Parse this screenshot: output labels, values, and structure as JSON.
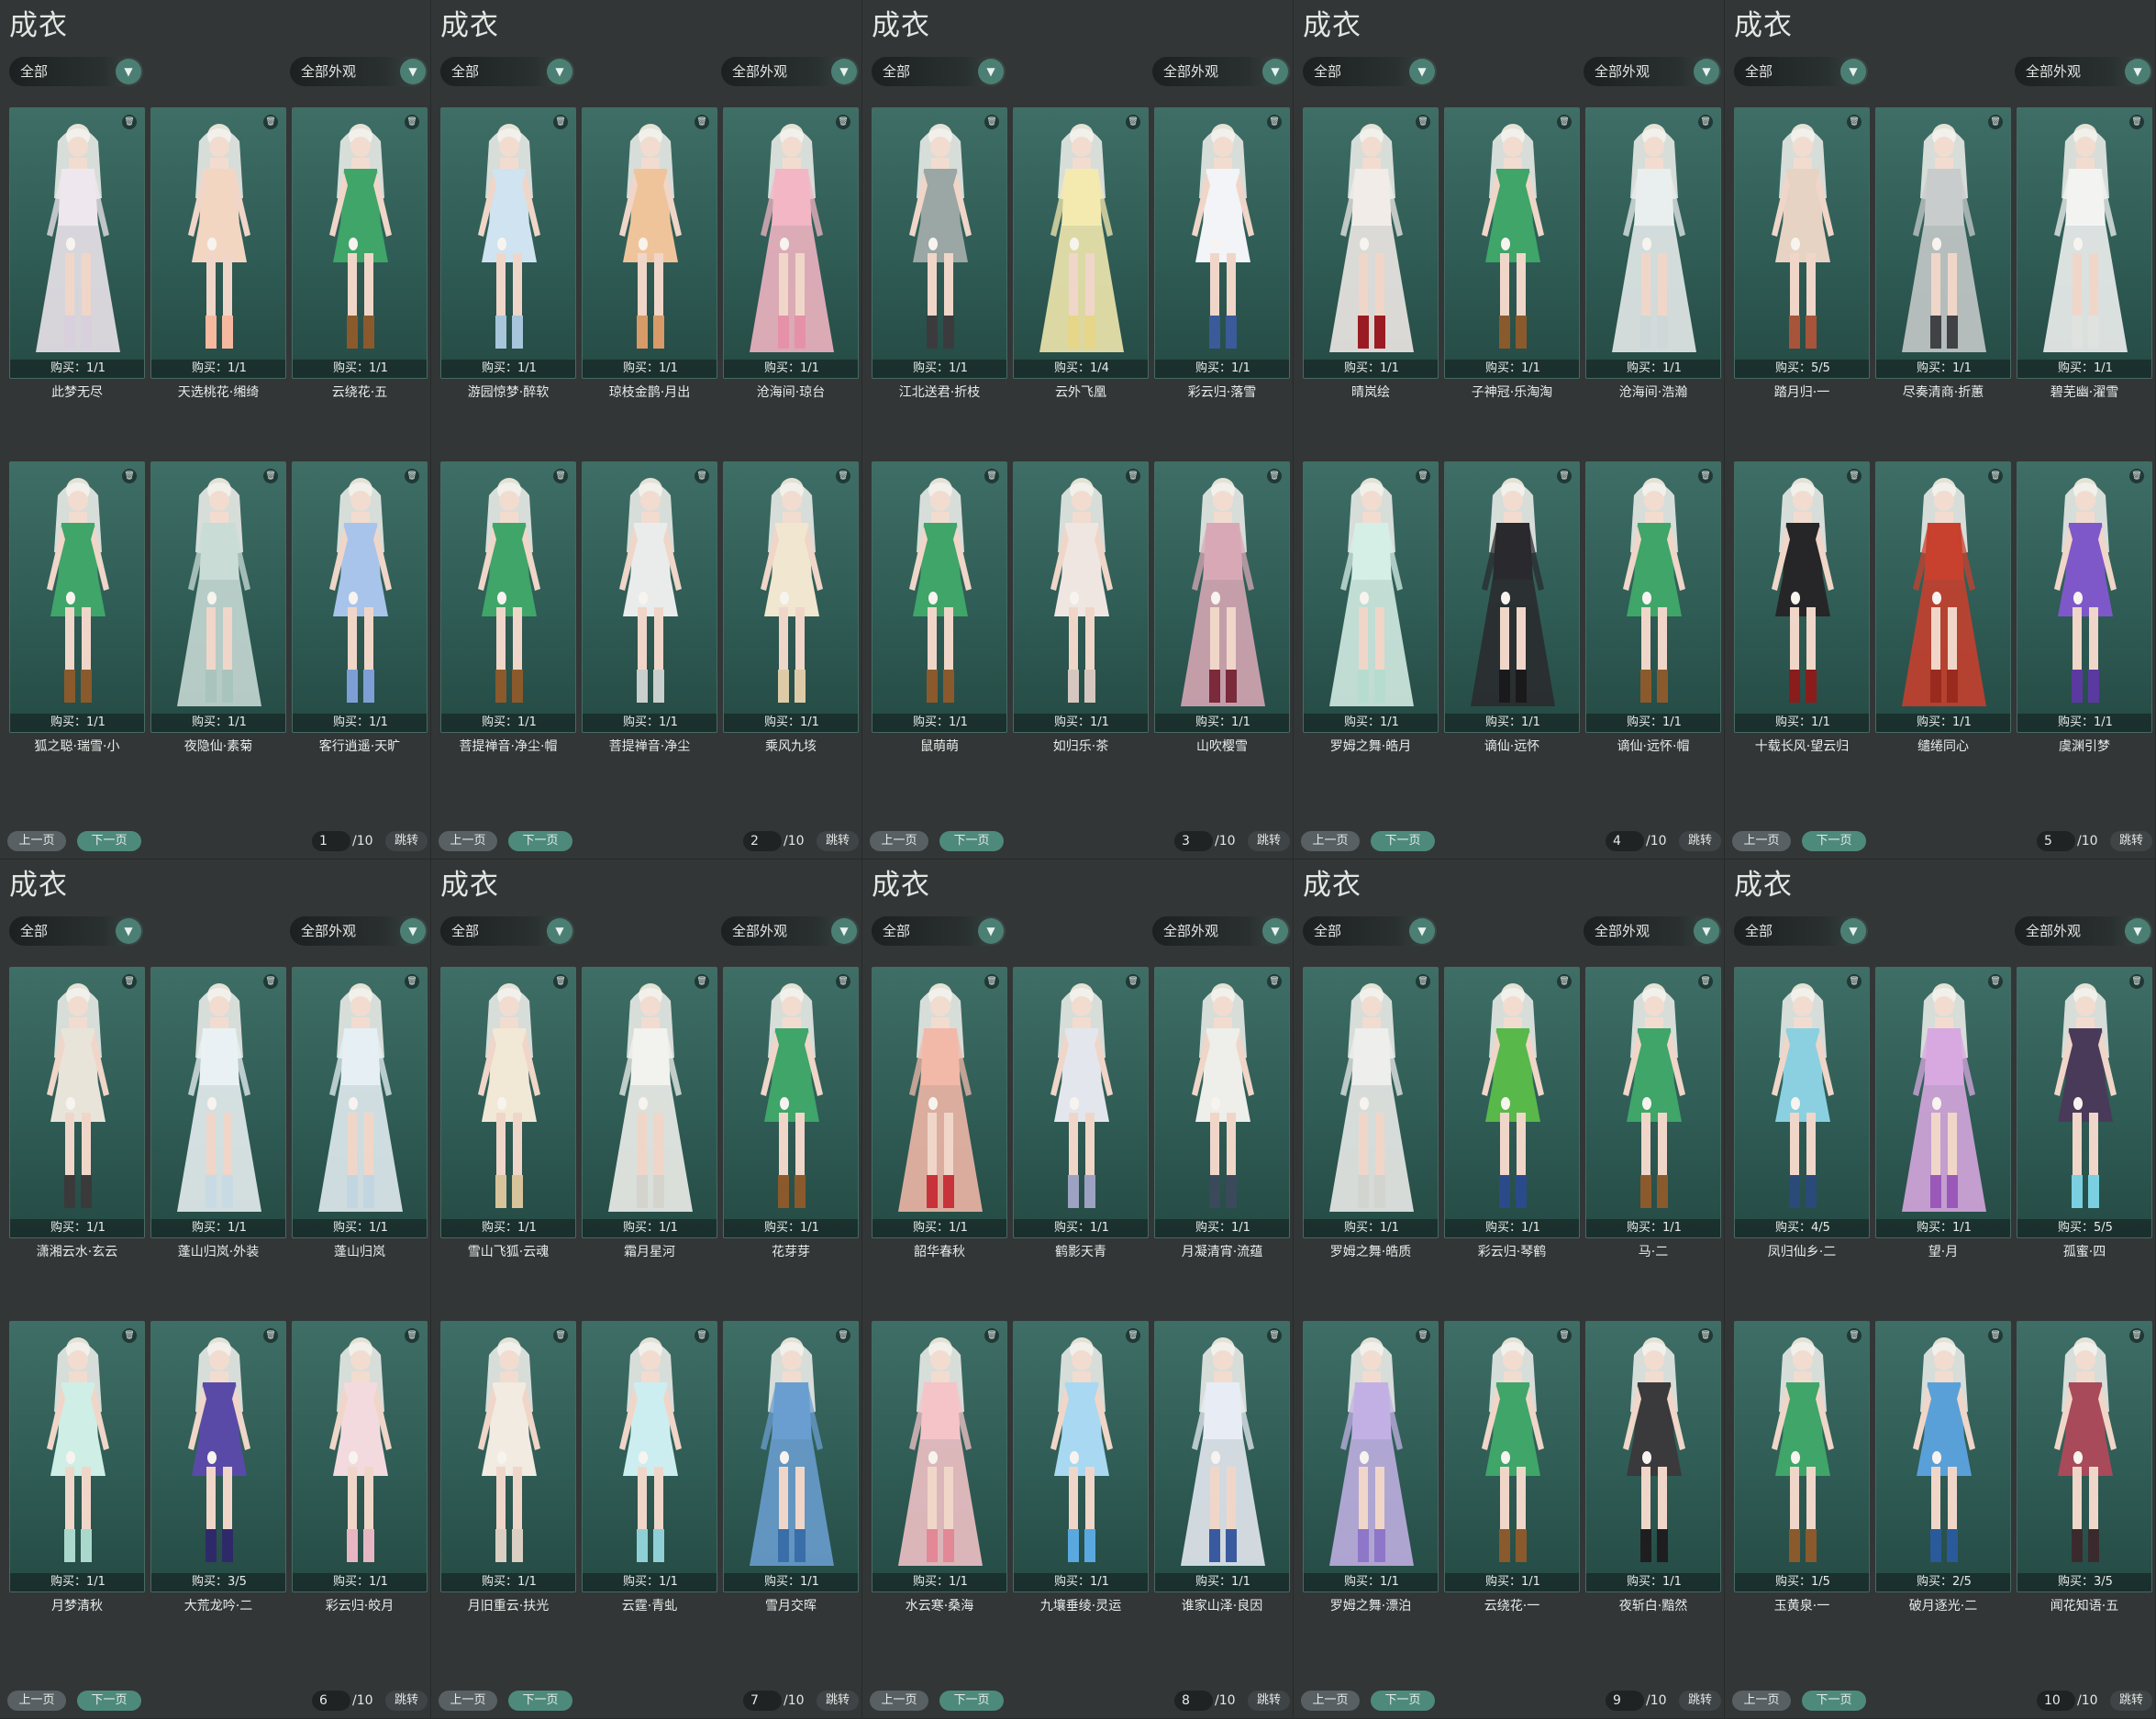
{
  "colors": {
    "bg": "#2f3335",
    "card": "#35625b",
    "accent": "#4d8a7b"
  },
  "icons": {
    "trash": "trash-icon",
    "dropdown": "chevron-down-icon"
  },
  "panels": [
    {
      "title": "成衣",
      "filter": "全部",
      "filter2": "全部外观",
      "items": [
        {
          "name": "此梦无尽",
          "buy": "购买：1/1",
          "skin": "#efe7ee",
          "acc": "#d8d0dc",
          "long": true
        },
        {
          "name": "天选桃花·缃绮",
          "buy": "购买：1/1",
          "skin": "#f3d6c2",
          "acc": "#f6b9a0",
          "long": false
        },
        {
          "name": "云绕花·五",
          "buy": "购买：1/1",
          "skin": "#3fa569",
          "acc": "#8a5a2c",
          "long": false
        },
        {
          "name": "狐之聪·瑞雪·小",
          "buy": "购买：1/1",
          "skin": "#3fa569",
          "acc": "#8a5a2c",
          "long": false
        },
        {
          "name": "夜隐仙·素菊",
          "buy": "购买：1/1",
          "skin": "#c9dcd6",
          "acc": "#a8c4bd",
          "long": true
        },
        {
          "name": "客行逍遥·天旷",
          "buy": "购买：1/1",
          "skin": "#a8c4ea",
          "acc": "#7e9fd6",
          "long": false
        }
      ],
      "page": "1",
      "total": "/10"
    },
    {
      "title": "成衣",
      "filter": "全部",
      "filter2": "全部外观",
      "items": [
        {
          "name": "游园惊梦·醉软",
          "buy": "购买：1/1",
          "skin": "#cfe3f0",
          "acc": "#a7c6dc",
          "long": false
        },
        {
          "name": "琼枝金鹊·月出",
          "buy": "购买：1/1",
          "skin": "#f0c49a",
          "acc": "#d89a68",
          "long": false
        },
        {
          "name": "沧海间·琼台",
          "buy": "购买：1/1",
          "skin": "#f2b6c4",
          "acc": "#e592a8",
          "long": true
        },
        {
          "name": "菩提禅音·净尘·帽",
          "buy": "购买：1/1",
          "skin": "#3fa569",
          "acc": "#8a5a2c",
          "long": false
        },
        {
          "name": "菩提禅音·净尘",
          "buy": "购买：1/1",
          "skin": "#eaeceb",
          "acc": "#c9cfcc",
          "long": false
        },
        {
          "name": "乘风九垓",
          "buy": "购买：1/1",
          "skin": "#f1e6cf",
          "acc": "#dccba6",
          "long": false
        }
      ],
      "page": "2",
      "total": "/10"
    },
    {
      "title": "成衣",
      "filter": "全部",
      "filter2": "全部外观",
      "items": [
        {
          "name": "江北送君·折枝",
          "buy": "购买：1/1",
          "skin": "#9aa7a4",
          "acc": "#3b3b3d",
          "long": false
        },
        {
          "name": "云外飞凰",
          "buy": "购买：1/4",
          "skin": "#f4eab0",
          "acc": "#e6d68a",
          "long": true
        },
        {
          "name": "彩云归·落雪",
          "buy": "购买：1/1",
          "skin": "#f2f4f7",
          "acc": "#3a5a9a",
          "long": false
        },
        {
          "name": "鼠萌萌",
          "buy": "购买：1/1",
          "skin": "#3fa569",
          "acc": "#8a5a2c",
          "long": false
        },
        {
          "name": "如归乐·茶",
          "buy": "购买：1/1",
          "skin": "#efe6e2",
          "acc": "#d5c6c0",
          "long": false
        },
        {
          "name": "山吹樱雪",
          "buy": "购买：1/1",
          "skin": "#d8a8b6",
          "acc": "#7a2a3a",
          "long": true
        }
      ],
      "page": "3",
      "total": "/10"
    },
    {
      "title": "成衣",
      "filter": "全部",
      "filter2": "全部外观",
      "items": [
        {
          "name": "晴岚绘",
          "buy": "购买：1/1",
          "skin": "#f2ece8",
          "acc": "#9a1c22",
          "long": true
        },
        {
          "name": "子神冠·乐淘淘",
          "buy": "购买：1/1",
          "skin": "#3fa569",
          "acc": "#8a5a2c",
          "long": false
        },
        {
          "name": "沧海间·浩瀚",
          "buy": "购买：1/1",
          "skin": "#e9eeee",
          "acc": "#cfd8d8",
          "long": true
        },
        {
          "name": "罗姆之舞·皓月",
          "buy": "购买：1/1",
          "skin": "#d6efe6",
          "acc": "#b6dccf",
          "long": true
        },
        {
          "name": "谪仙·远怀",
          "buy": "购买：1/1",
          "skin": "#2a2a2e",
          "acc": "#1a1a1c",
          "long": true
        },
        {
          "name": "谪仙·远怀·帽",
          "buy": "购买：1/1",
          "skin": "#3fa569",
          "acc": "#8a5a2c",
          "long": false
        }
      ],
      "page": "4",
      "total": "/10"
    },
    {
      "title": "成衣",
      "filter": "全部",
      "filter2": "全部外观",
      "items": [
        {
          "name": "踏月归·一",
          "buy": "购买：5/5",
          "skin": "#e6d3c4",
          "acc": "#a8543a",
          "long": false
        },
        {
          "name": "尽奏清商·折蕙",
          "buy": "购买：1/1",
          "skin": "#c8cccc",
          "acc": "#404246",
          "long": true
        },
        {
          "name": "碧芜幽·濯雪",
          "buy": "购买：1/1",
          "skin": "#f3f4f2",
          "acc": "#dfe2df",
          "long": true
        },
        {
          "name": "十载长风·望云归",
          "buy": "购买：1/1",
          "skin": "#262628",
          "acc": "#8a1c1c",
          "long": false
        },
        {
          "name": "缱绻同心",
          "buy": "购买：1/1",
          "skin": "#c8402e",
          "acc": "#9a2a1e",
          "long": true
        },
        {
          "name": "虞渊引梦",
          "buy": "购买：1/1",
          "skin": "#7e58c8",
          "acc": "#5a3aa0",
          "long": false
        }
      ],
      "page": "5",
      "total": "/10"
    },
    {
      "title": "成衣",
      "filter": "全部",
      "filter2": "全部外观",
      "items": [
        {
          "name": "潇湘云水·玄云",
          "buy": "购买：1/1",
          "skin": "#e8e4da",
          "acc": "#3a3a3a",
          "long": false
        },
        {
          "name": "蓬山归岚·外装",
          "buy": "购买：1/1",
          "skin": "#eaf1f4",
          "acc": "#c8dbe4",
          "long": true
        },
        {
          "name": "蓬山归岚",
          "buy": "购买：1/1",
          "skin": "#e6eff4",
          "acc": "#c2d6e2",
          "long": true
        },
        {
          "name": "月梦清秋",
          "buy": "购买：1/1",
          "skin": "#cfeee6",
          "acc": "#aad8cc",
          "long": false
        },
        {
          "name": "大荒龙吟·二",
          "buy": "购买：3/5",
          "skin": "#5a4aa8",
          "acc": "#2e2a6a",
          "long": false
        },
        {
          "name": "彩云归·皎月",
          "buy": "购买：1/1",
          "skin": "#f3dadf",
          "acc": "#e6b6c2",
          "long": false
        }
      ],
      "page": "6",
      "total": "/10"
    },
    {
      "title": "成衣",
      "filter": "全部",
      "filter2": "全部外观",
      "items": [
        {
          "name": "雪山飞狐·云魂",
          "buy": "购买：1/1",
          "skin": "#f2e8d6",
          "acc": "#d8c49a",
          "long": false
        },
        {
          "name": "霜月星河",
          "buy": "购买：1/1",
          "skin": "#f2f2ee",
          "acc": "#d4d4cc",
          "long": true
        },
        {
          "name": "花芽芽",
          "buy": "购买：1/1",
          "skin": "#3fa569",
          "acc": "#8a5a2c",
          "long": false
        },
        {
          "name": "月旧重云·扶光",
          "buy": "购买：1/1",
          "skin": "#f1ebe2",
          "acc": "#d9cfc2",
          "long": false
        },
        {
          "name": "云霆·青虬",
          "buy": "购买：1/1",
          "skin": "#cdeef0",
          "acc": "#8fd0d6",
          "long": false
        },
        {
          "name": "雪月交晖",
          "buy": "购买：1/1",
          "skin": "#6a9ed0",
          "acc": "#3a6ea8",
          "long": true
        }
      ],
      "page": "7",
      "total": "/10"
    },
    {
      "title": "成衣",
      "filter": "全部",
      "filter2": "全部外观",
      "items": [
        {
          "name": "韶华春秋",
          "buy": "购买：1/1",
          "skin": "#f2b8a8",
          "acc": "#c8323a",
          "long": true
        },
        {
          "name": "鹤影天青",
          "buy": "购买：1/1",
          "skin": "#e4e6ee",
          "acc": "#9ea2c2",
          "long": false
        },
        {
          "name": "月凝清宵·流蕴",
          "buy": "购买：1/1",
          "skin": "#eeeeea",
          "acc": "#3a4a5a",
          "long": false
        },
        {
          "name": "水云寒·桑海",
          "buy": "购买：1/1",
          "skin": "#f4c4c8",
          "acc": "#e28896",
          "long": true
        },
        {
          "name": "九壤垂绫·灵运",
          "buy": "购买：1/1",
          "skin": "#a8d8f2",
          "acc": "#5aa8e0",
          "long": false
        },
        {
          "name": "谁家山泽·良因",
          "buy": "购买：1/1",
          "skin": "#e8ecf4",
          "acc": "#3a5aa0",
          "long": true
        }
      ],
      "page": "8",
      "total": "/10"
    },
    {
      "title": "成衣",
      "filter": "全部",
      "filter2": "全部外观",
      "items": [
        {
          "name": "罗姆之舞·皓质",
          "buy": "购买：1/1",
          "skin": "#eeeeec",
          "acc": "#d2d4d0",
          "long": true
        },
        {
          "name": "彩云归·琴鹤",
          "buy": "购买：1/1",
          "skin": "#58b84a",
          "acc": "#2a4a8a",
          "long": false
        },
        {
          "name": "马·二",
          "buy": "购买：1/1",
          "skin": "#3fa569",
          "acc": "#8a5a2c",
          "long": false
        },
        {
          "name": "罗姆之舞·漂泊",
          "buy": "购买：1/1",
          "skin": "#c2b0e4",
          "acc": "#8e76c8",
          "long": true
        },
        {
          "name": "云绕花·一",
          "buy": "购买：1/1",
          "skin": "#3fa569",
          "acc": "#8a5a2c",
          "long": false
        },
        {
          "name": "夜斩白·黯然",
          "buy": "购买：1/1",
          "skin": "#3a3a3c",
          "acc": "#1e1e20",
          "long": false
        }
      ],
      "page": "9",
      "total": "/10"
    },
    {
      "title": "成衣",
      "filter": "全部",
      "filter2": "全部外观",
      "items": [
        {
          "name": "凤归仙乡·二",
          "buy": "购买：4/5",
          "skin": "#8ad0e0",
          "acc": "#2a4a7a",
          "long": false
        },
        {
          "name": "望·月",
          "buy": "购买：1/1",
          "skin": "#d8a8e0",
          "acc": "#9a58b8",
          "long": true
        },
        {
          "name": "孤蜜·四",
          "buy": "购买：5/5",
          "skin": "#4a3a5a",
          "acc": "#7ad0e0",
          "long": false
        },
        {
          "name": "玉黄泉·一",
          "buy": "购买：1/5",
          "skin": "#3fa569",
          "acc": "#8a5a2c",
          "long": false
        },
        {
          "name": "破月逐光·二",
          "buy": "购买：2/5",
          "skin": "#5aa0d8",
          "acc": "#2a5a9a",
          "long": false
        },
        {
          "name": "闻花知语·五",
          "buy": "购买：3/5",
          "skin": "#a84a5a",
          "acc": "#3a2a2e",
          "long": false
        }
      ],
      "page": "10",
      "total": "/10"
    }
  ],
  "pager": {
    "prev": "上一页",
    "next": "下一页",
    "jump": "跳转"
  }
}
